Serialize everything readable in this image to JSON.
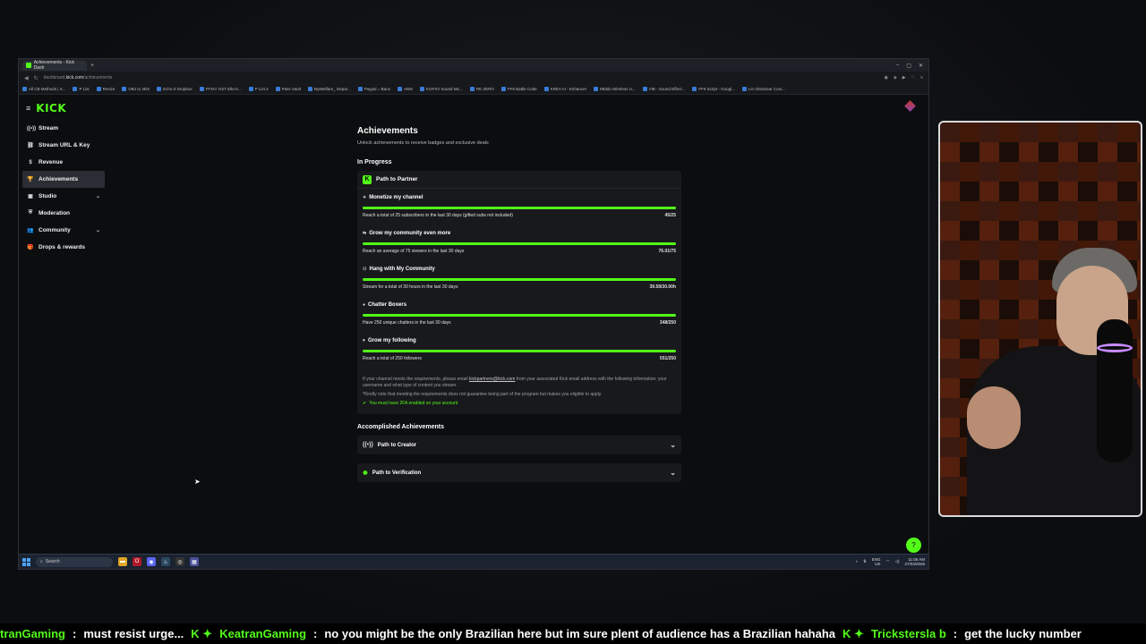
{
  "browser": {
    "tab_title": "Achievements - Kick Dash",
    "url_prefix": "dashboard.",
    "url_domain": "kick.com",
    "url_path": "/achievements",
    "bookmarks": [
      "All CB Methods | S...",
      "P List",
      "Resize",
      "OBJ to 3DS",
      "Echo-3 Dropbox",
      "FFXIV OST Elko's...",
      "P List 2",
      "Pass Vault",
      "MyWelfare_ Depar...",
      "Paypal = Banx",
      "AWS",
      "KOFXV Sound Mo...",
      "RE ZERO",
      "FF8 Battle Code",
      "KREA AI - Enhancer",
      "8Bitdo Wireless U...",
      "VIB - Sound Effect...",
      "FF9 Script - Googl...",
      "LG UltraGear Curv..."
    ]
  },
  "sidebar": {
    "logo": "KICK",
    "items": [
      {
        "label": "Stream",
        "icon": "broadcast-icon",
        "glyph": "((•))"
      },
      {
        "label": "Stream URL & Key",
        "icon": "link-icon",
        "glyph": "⛓"
      },
      {
        "label": "Revenue",
        "icon": "dollar-icon",
        "glyph": "$"
      },
      {
        "label": "Achievements",
        "icon": "trophy-icon",
        "glyph": "🏆"
      },
      {
        "label": "Studio",
        "icon": "studio-icon",
        "glyph": "▣"
      },
      {
        "label": "Moderation",
        "icon": "shield-icon",
        "glyph": "⛨"
      },
      {
        "label": "Community",
        "icon": "people-icon",
        "glyph": "👥"
      },
      {
        "label": "Drops & rewards",
        "icon": "gift-icon",
        "glyph": "🎁"
      }
    ]
  },
  "main": {
    "title": "Achievements",
    "subtitle": "Unlock achievements to receive badges and exclusive deals",
    "in_progress_label": "In Progress",
    "path_to_partner": "Path to Partner",
    "tasks": [
      {
        "title": "Monetize my channel",
        "desc": "Reach a total of 25 subscribers in the last 30 days (gifted subs not included)",
        "value": "45/25",
        "progress": 1.0
      },
      {
        "title": "Grow my community even more",
        "desc": "Reach an average of 75 viewers in the last 30 days",
        "value": "76.01/75",
        "progress": 1.0
      },
      {
        "title": "Hang with My Community",
        "desc": "Stream for a total of 30 hours in the last 30 days",
        "value": "39.59/30.00h",
        "progress": 1.0
      },
      {
        "title": "Chatter Boxers",
        "desc": "Have 250 unique chatters in the last 30 days",
        "value": "348/250",
        "progress": 1.0
      },
      {
        "title": "Grow my following",
        "desc": "Reach a total of 250 followers",
        "value": "551/250",
        "progress": 1.0
      }
    ],
    "note_1a": "If your channel meets the requirements, please email ",
    "note_email": "kickpartners@kick.com",
    "note_1b": " from your associated Kick email address with the following information: your username and what type of content you stream.",
    "note_2": "*Kindly note that meeting the requirements does not guarantee being part of the program but makes you eligible to apply.",
    "note_2fa": "You must have 2FA enabled on your account",
    "accomplished_label": "Accomplished Achievements",
    "accomplished": [
      {
        "label": "Path to Creator"
      },
      {
        "label": "Path to Verification"
      }
    ]
  },
  "taskbar": {
    "search_placeholder": "Search",
    "lang": "ENG",
    "region": "UK",
    "time": "11:05 AM",
    "date": "27/03/2026"
  },
  "ticker": {
    "messages": [
      {
        "user": "tranGaming",
        "text": "must resist urge..."
      },
      {
        "user": "KeatranGaming",
        "text": "no you might be the only Brazilian here but im sure plent of audience has a Brazilian hahaha"
      },
      {
        "user": "Trickstersla b",
        "text": "get the lucky number"
      }
    ]
  },
  "colors": {
    "accent": "#53fc18",
    "bg": "#0b0d0f",
    "card": "#18191c"
  }
}
